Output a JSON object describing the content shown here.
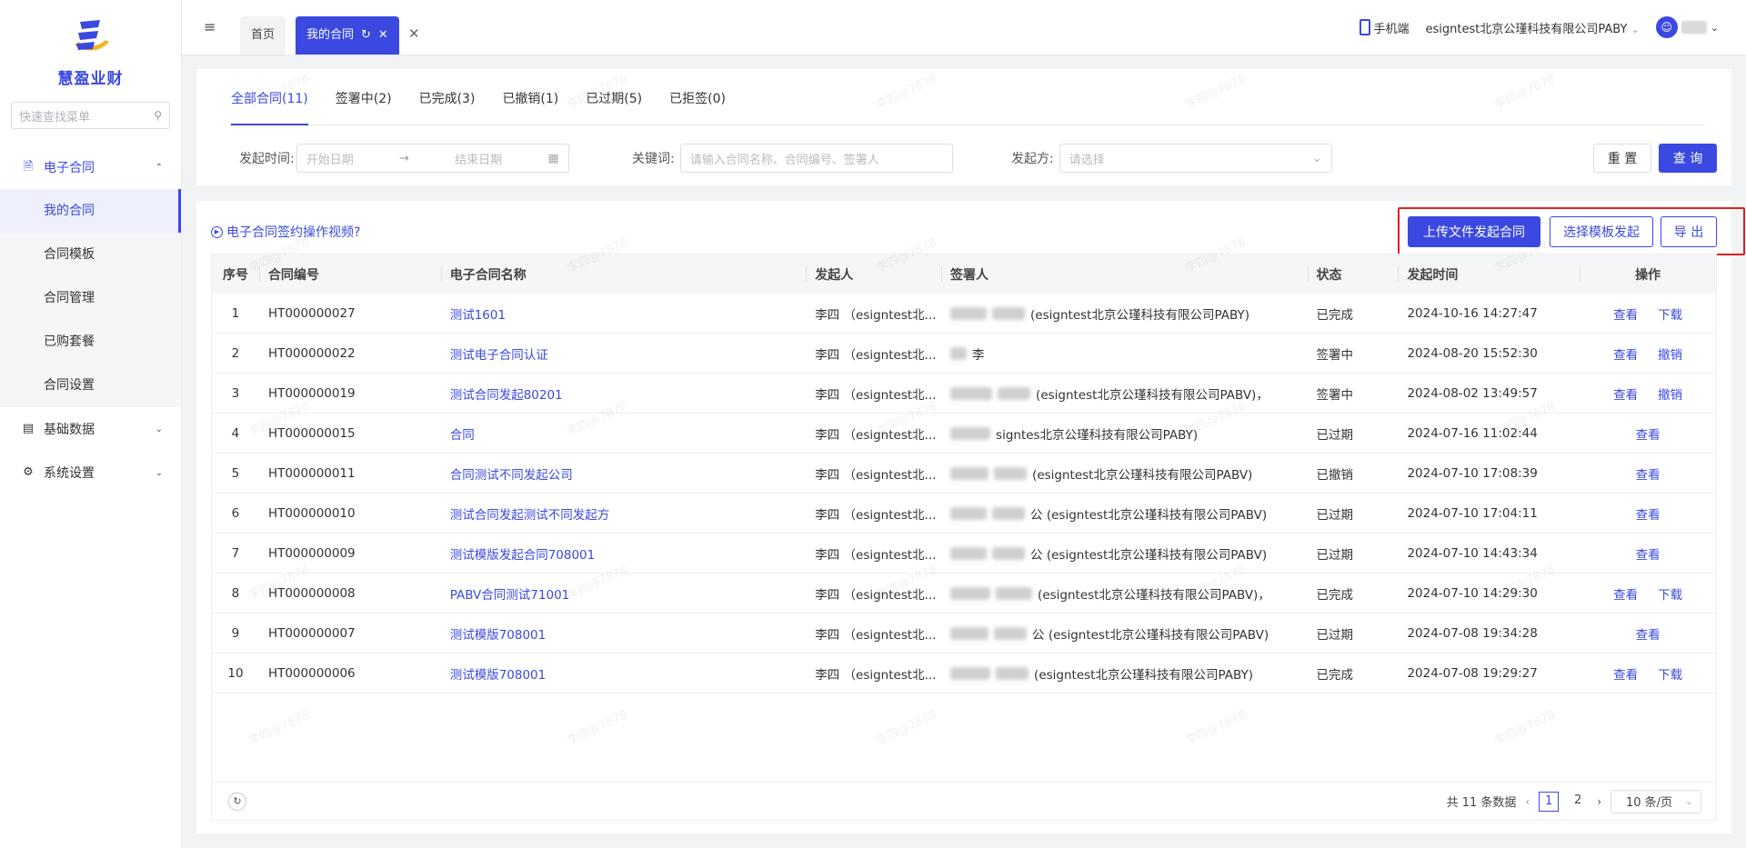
{
  "app": {
    "name": "慧盈业财",
    "search_placeholder": "快速查找菜单"
  },
  "sidebar": {
    "groups": [
      {
        "label": "电子合同",
        "icon": "contract-icon",
        "expanded": true,
        "items": [
          {
            "label": "我的合同",
            "active": true
          },
          {
            "label": "合同模板"
          },
          {
            "label": "合同管理"
          },
          {
            "label": "已购套餐"
          },
          {
            "label": "合同设置"
          }
        ]
      },
      {
        "label": "基础数据",
        "icon": "database-icon",
        "expanded": false
      },
      {
        "label": "系统设置",
        "icon": "gear-icon",
        "expanded": false
      }
    ]
  },
  "topbar": {
    "tabs": [
      {
        "label": "首页"
      },
      {
        "label": "我的合同",
        "active": true
      }
    ],
    "mobile_label": "手机端",
    "company": "esigntest北京公瑾科技有限公司PABY"
  },
  "filters": {
    "status_tabs": [
      "全部合同(11)",
      "签署中(2)",
      "已完成(3)",
      "已撤销(1)",
      "已过期(5)",
      "已拒签(0)"
    ],
    "date_label": "发起时间:",
    "start_placeholder": "开始日期",
    "date_sep": "→",
    "end_placeholder": "结束日期",
    "keyword_label": "关键词:",
    "keyword_placeholder": "请输入合同名称、合同编号、签署人",
    "initiator_label": "发起方:",
    "initiator_placeholder": "请选择",
    "reset_label": "重 置",
    "query_label": "查 询"
  },
  "main": {
    "video_link": "电子合同签约操作视频?",
    "upload_button": "上传文件发起合同",
    "template_button": "选择模板发起",
    "export_button": "导 出",
    "columns": [
      "序号",
      "合同编号",
      "电子合同名称",
      "发起人",
      "签署人",
      "状态",
      "发起时间",
      "操作"
    ],
    "rows": [
      {
        "idx": "1",
        "no": "HT000000027",
        "name": "测试1601",
        "initiator": "李四 （esigntest北...",
        "signer": "(esigntest北京公瑾科技有限公司PABY)",
        "status": "已完成",
        "time": "2024-10-16 14:27:47",
        "ops": [
          "查看",
          "下载"
        ]
      },
      {
        "idx": "2",
        "no": "HT000000022",
        "name": "测试电子合同认证",
        "initiator": "李四 （esigntest北...",
        "signer": "李",
        "status": "签署中",
        "time": "2024-08-20 15:52:30",
        "ops": [
          "查看",
          "撤销"
        ]
      },
      {
        "idx": "3",
        "no": "HT000000019",
        "name": "测试合同发起80201",
        "initiator": "李四 （esigntest北...",
        "signer": "(esigntest北京公瑾科技有限公司PABV)，",
        "status": "签署中",
        "time": "2024-08-02 13:49:57",
        "ops": [
          "查看",
          "撤销"
        ]
      },
      {
        "idx": "4",
        "no": "HT000000015",
        "name": "合同",
        "initiator": "李四 （esigntest北...",
        "signer": "signtes北京公瑾科技有限公司PABY)",
        "status": "已过期",
        "time": "2024-07-16 11:02:44",
        "ops": [
          "查看"
        ]
      },
      {
        "idx": "5",
        "no": "HT000000011",
        "name": "合同测试不同发起公司",
        "initiator": "李四 （esigntest北...",
        "signer": "(esigntest北京公瑾科技有限公司PABV)",
        "status": "已撤销",
        "time": "2024-07-10 17:08:39",
        "ops": [
          "查看"
        ]
      },
      {
        "idx": "6",
        "no": "HT000000010",
        "name": "测试合同发起测试不同发起方",
        "initiator": "李四 （esigntest北...",
        "signer": "公 (esigntest北京公瑾科技有限公司PABV)",
        "status": "已过期",
        "time": "2024-07-10 17:04:11",
        "ops": [
          "查看"
        ]
      },
      {
        "idx": "7",
        "no": "HT000000009",
        "name": "测试模版发起合同708001",
        "initiator": "李四 （esigntest北...",
        "signer": "公 (esigntest北京公瑾科技有限公司PABV)",
        "status": "已过期",
        "time": "2024-07-10 14:43:34",
        "ops": [
          "查看"
        ]
      },
      {
        "idx": "8",
        "no": "HT000000008",
        "name": "PABV合同测试71001",
        "initiator": "李四 （esigntest北...",
        "signer": "(esigntest北京公瑾科技有限公司PABV)，",
        "status": "已完成",
        "time": "2024-07-10 14:29:30",
        "ops": [
          "查看",
          "下载"
        ]
      },
      {
        "idx": "9",
        "no": "HT000000007",
        "name": "测试模版708001",
        "initiator": "李四 （esigntest北...",
        "signer": "公 (esigntest北京公瑾科技有限公司PABV)",
        "status": "已过期",
        "time": "2024-07-08 19:34:28",
        "ops": [
          "查看"
        ]
      },
      {
        "idx": "10",
        "no": "HT000000006",
        "name": "测试模版708001",
        "initiator": "李四 （esigntest北...",
        "signer": "(esigntest北京公瑾科技有限公司PABY)",
        "status": "已完成",
        "time": "2024-07-08 19:29:27",
        "ops": [
          "查看",
          "下载"
        ]
      }
    ],
    "total_label": "共 11 条数据",
    "pages": [
      "1",
      "2"
    ],
    "current_page": "1",
    "page_size": "10 条/页"
  },
  "colors": {
    "primary": "#3b49e0",
    "highlight": "#e02020"
  }
}
